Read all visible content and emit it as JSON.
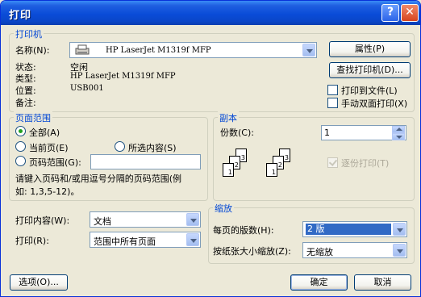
{
  "window": {
    "title": "打印"
  },
  "title_buttons": {
    "help": "?",
    "close": "✕"
  },
  "printer": {
    "group_title": "打印机",
    "name_label": "名称(N):",
    "name_value": "HP LaserJet M1319f MFP",
    "status_label": "状态:",
    "status_value": "空闲",
    "type_label": "类型:",
    "type_value": "HP LaserJet M1319f MFP",
    "where_label": "位置:",
    "where_value": "USB001",
    "comment_label": "备注:",
    "comment_value": "",
    "properties_button": "属性(P)",
    "find_button": "查找打印机(D)...",
    "print_to_file": "打印到文件(L)",
    "manual_duplex": "手动双面打印(X)"
  },
  "page_range": {
    "group_title": "页面范围",
    "all": "全部(A)",
    "current": "当前页(E)",
    "selection": "所选内容(S)",
    "pages": "页码范围(G):",
    "pages_value": "",
    "hint_line1": "请键入页码和/或用逗号分隔的页码范围(例",
    "hint_line2": "如: 1,3,5-12)。"
  },
  "copies": {
    "group_title": "副本",
    "count_label": "份数(C):",
    "count_value": "1",
    "collate": "逐份打印(T)",
    "icon_pages": [
      "1",
      "2",
      "3",
      "1",
      "2",
      "3"
    ]
  },
  "print_what": {
    "label": "打印内容(W):",
    "value": "文档"
  },
  "print_range": {
    "label": "打印(R):",
    "value": "范围中所有页面"
  },
  "zoom": {
    "group_title": "缩放",
    "pages_per_sheet_label": "每页的版数(H):",
    "pages_per_sheet_value": "2 版",
    "scale_label": "按纸张大小缩放(Z):",
    "scale_value": "无缩放"
  },
  "footer": {
    "options_button": "选项(O)...",
    "ok_button": "确定",
    "cancel_button": "取消"
  }
}
